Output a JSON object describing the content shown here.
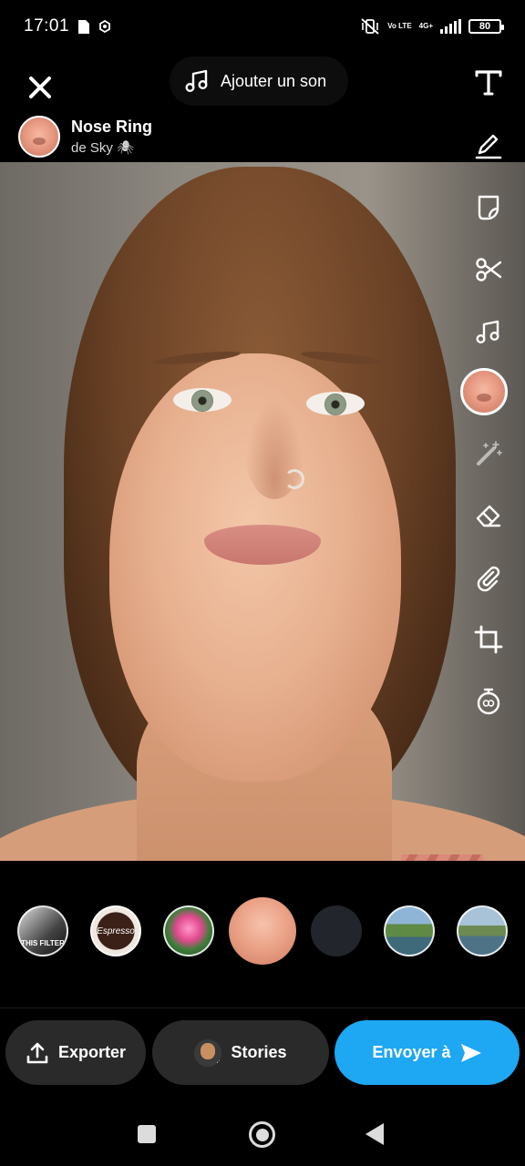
{
  "status_bar": {
    "time": "17:01",
    "battery": "80",
    "network": "4G+",
    "volte": "Vo LTE"
  },
  "header": {
    "close_icon": "close-icon",
    "sound_button_label": "Ajouter un son",
    "lens_name": "Nose Ring",
    "lens_author": "de Sky 🕷"
  },
  "toolbar": {
    "tools": [
      "text-icon",
      "pen-icon",
      "sticker-icon",
      "scissors-icon",
      "music-icon",
      "lens-icon",
      "magic-wand-icon",
      "eraser-icon",
      "paperclip-icon",
      "crop-icon",
      "timer-icon"
    ]
  },
  "carousel": {
    "lenses": [
      {
        "name": "lens-thumb-bw",
        "label": "THIS FILTER"
      },
      {
        "name": "lens-thumb-espresso",
        "label": "Espresso"
      },
      {
        "name": "lens-thumb-rose",
        "label": ""
      },
      {
        "name": "lens-thumb-nose-ring",
        "label": ""
      },
      {
        "name": "lens-thumb-dark",
        "label": ""
      },
      {
        "name": "lens-thumb-landscape-1",
        "label": ""
      },
      {
        "name": "lens-thumb-landscape-2",
        "label": ""
      }
    ]
  },
  "actions": {
    "export_label": "Exporter",
    "stories_label": "Stories",
    "send_label": "Envoyer à"
  },
  "colors": {
    "send_button": "#1ea7f2",
    "secondary_button": "#2a2a2a",
    "background": "#000000"
  }
}
